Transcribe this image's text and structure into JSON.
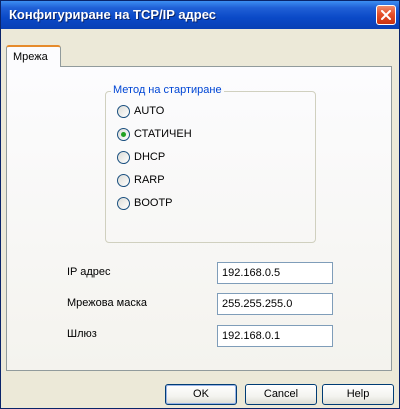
{
  "window": {
    "title": "Конфигуриране на TCP/IP адрес"
  },
  "tabs": [
    {
      "label": "Мрежа",
      "selected": true
    }
  ],
  "boot_method": {
    "legend": "Метод на стартиране",
    "options": [
      {
        "label": "AUTO",
        "checked": false
      },
      {
        "label": "СТАТИЧЕН",
        "checked": true
      },
      {
        "label": "DHCP",
        "checked": false
      },
      {
        "label": "RARP",
        "checked": false
      },
      {
        "label": "BOOTP",
        "checked": false
      }
    ]
  },
  "fields": {
    "ip": {
      "label": "IP адрес",
      "value": "192.168.0.5"
    },
    "mask": {
      "label": "Мрежова маска",
      "value": "255.255.255.0"
    },
    "gateway": {
      "label": "Шлюз",
      "value": "192.168.0.1"
    }
  },
  "buttons": {
    "ok": "OK",
    "cancel": "Cancel",
    "help": "Help"
  },
  "colors": {
    "title_bar": "#0a49c7",
    "tab_highlight": "#e68b2c",
    "legend_text": "#0046d5",
    "radio_selected": "#21a121",
    "close_button": "#e5502a"
  }
}
